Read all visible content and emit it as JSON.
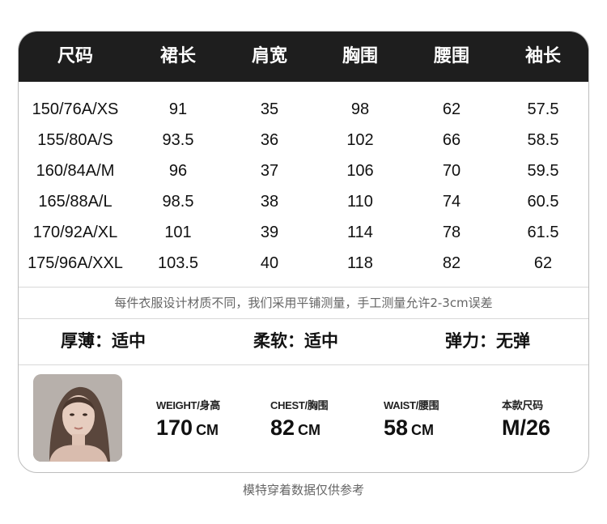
{
  "table": {
    "headers": [
      "尺码",
      "裙长",
      "肩宽",
      "胸围",
      "腰围",
      "袖长"
    ],
    "rows": [
      [
        "150/76A/XS",
        "91",
        "35",
        "98",
        "62",
        "57.5"
      ],
      [
        "155/80A/S",
        "93.5",
        "36",
        "102",
        "66",
        "58.5"
      ],
      [
        "160/84A/M",
        "96",
        "37",
        "106",
        "70",
        "59.5"
      ],
      [
        "165/88A/L",
        "98.5",
        "38",
        "110",
        "74",
        "60.5"
      ],
      [
        "170/92A/XL",
        "101",
        "39",
        "114",
        "78",
        "61.5"
      ],
      [
        "175/96A/XXL",
        "103.5",
        "40",
        "118",
        "82",
        "62"
      ]
    ]
  },
  "note": "每件衣服设计材质不同，我们采用平铺测量，手工测量允许2-3cm误差",
  "attributes": {
    "thickness": "厚薄：适中",
    "softness": "柔软：适中",
    "elasticity": "弹力：无弹"
  },
  "model": {
    "weight_label": "WEIGHT/身高",
    "weight_value": "170",
    "weight_unit": "CM",
    "chest_label": "CHEST/胸围",
    "chest_value": "82",
    "chest_unit": "CM",
    "waist_label": "WAIST/腰围",
    "waist_value": "58",
    "waist_unit": "CM",
    "size_label": "本款尺码",
    "size_value": "M/26"
  },
  "footer": "模特穿着数据仅供参考"
}
